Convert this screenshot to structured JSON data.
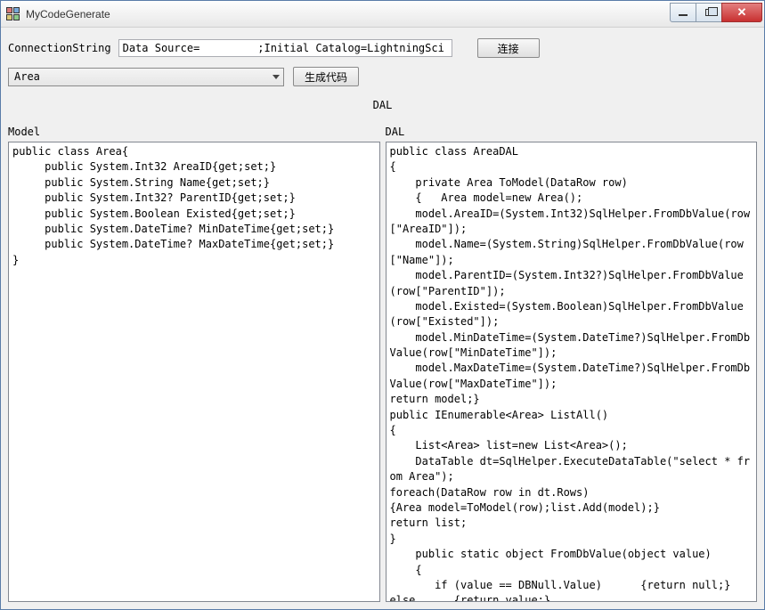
{
  "window": {
    "title": "MyCodeGenerate"
  },
  "row1": {
    "conn_label": "ConnectionString",
    "conn_value": "Data Source=         ;Initial Catalog=LightningSci",
    "connect_btn": "连接"
  },
  "row2": {
    "combo_selected": "Area",
    "gen_btn": "生成代码"
  },
  "center_label": "DAL",
  "left_panel": {
    "label": "Model",
    "code": "public class Area{\n     public System.Int32 AreaID{get;set;}\n     public System.String Name{get;set;}\n     public System.Int32? ParentID{get;set;}\n     public System.Boolean Existed{get;set;}\n     public System.DateTime? MinDateTime{get;set;}\n     public System.DateTime? MaxDateTime{get;set;}\n}"
  },
  "right_panel": {
    "label": "DAL",
    "code": "public class AreaDAL\n{\n    private Area ToModel(DataRow row)\n    {   Area model=new Area();\n    model.AreaID=(System.Int32)SqlHelper.FromDbValue(row[\"AreaID\"]);\n    model.Name=(System.String)SqlHelper.FromDbValue(row[\"Name\"]);\n    model.ParentID=(System.Int32?)SqlHelper.FromDbValue(row[\"ParentID\"]);\n    model.Existed=(System.Boolean)SqlHelper.FromDbValue(row[\"Existed\"]);\n    model.MinDateTime=(System.DateTime?)SqlHelper.FromDbValue(row[\"MinDateTime\"]);\n    model.MaxDateTime=(System.DateTime?)SqlHelper.FromDbValue(row[\"MaxDateTime\"]);\nreturn model;}\npublic IEnumerable<Area> ListAll()\n{\n    List<Area> list=new List<Area>();\n    DataTable dt=SqlHelper.ExecuteDataTable(\"select * from Area\");\nforeach(DataRow row in dt.Rows)\n{Area model=ToModel(row);list.Add(model);}\nreturn list;\n}\n    public static object FromDbValue(object value)\n    {\n       if (value == DBNull.Value)      {return null;}\nelse      {return value;}\n    }\n}\n|"
  }
}
